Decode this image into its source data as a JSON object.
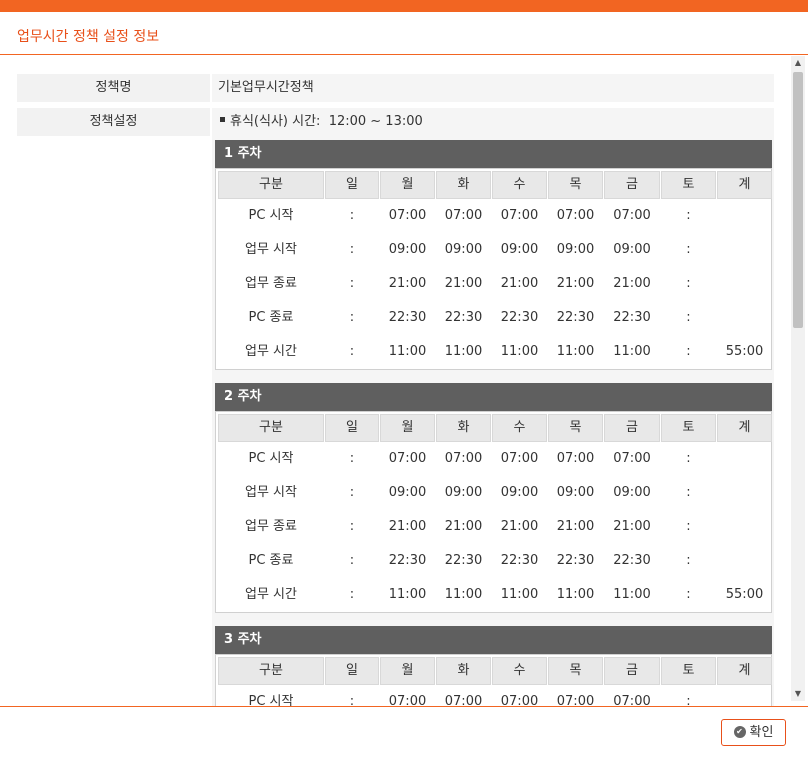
{
  "dialog": {
    "title": "업무시간 정책 설정 정보"
  },
  "fields": {
    "policy_name_label": "정책명",
    "policy_name_value": "기본업무시간정책",
    "policy_setting_label": "정책설정",
    "break_time_label": "휴식(식사) 시간:",
    "break_time_value": "12:00 ~ 13:00"
  },
  "table_headers": [
    "구분",
    "일",
    "월",
    "화",
    "수",
    "목",
    "금",
    "토",
    "계"
  ],
  "weeks": [
    {
      "title": "1 주차",
      "rows": [
        [
          "PC 시작",
          ":",
          "07:00",
          "07:00",
          "07:00",
          "07:00",
          "07:00",
          ":",
          ""
        ],
        [
          "업무 시작",
          ":",
          "09:00",
          "09:00",
          "09:00",
          "09:00",
          "09:00",
          ":",
          ""
        ],
        [
          "업무 종료",
          ":",
          "21:00",
          "21:00",
          "21:00",
          "21:00",
          "21:00",
          ":",
          ""
        ],
        [
          "PC 종료",
          ":",
          "22:30",
          "22:30",
          "22:30",
          "22:30",
          "22:30",
          ":",
          ""
        ],
        [
          "업무 시간",
          ":",
          "11:00",
          "11:00",
          "11:00",
          "11:00",
          "11:00",
          ":",
          "55:00"
        ]
      ]
    },
    {
      "title": "2 주차",
      "rows": [
        [
          "PC 시작",
          ":",
          "07:00",
          "07:00",
          "07:00",
          "07:00",
          "07:00",
          ":",
          ""
        ],
        [
          "업무 시작",
          ":",
          "09:00",
          "09:00",
          "09:00",
          "09:00",
          "09:00",
          ":",
          ""
        ],
        [
          "업무 종료",
          ":",
          "21:00",
          "21:00",
          "21:00",
          "21:00",
          "21:00",
          ":",
          ""
        ],
        [
          "PC 종료",
          ":",
          "22:30",
          "22:30",
          "22:30",
          "22:30",
          "22:30",
          ":",
          ""
        ],
        [
          "업무 시간",
          ":",
          "11:00",
          "11:00",
          "11:00",
          "11:00",
          "11:00",
          ":",
          "55:00"
        ]
      ]
    },
    {
      "title": "3 주차",
      "rows": [
        [
          "PC 시작",
          ":",
          "07:00",
          "07:00",
          "07:00",
          "07:00",
          "07:00",
          ":",
          ""
        ]
      ]
    }
  ],
  "footer": {
    "ok_label": "확인"
  },
  "colors": {
    "accent": "#f26522",
    "week_header": "#5f5f5f"
  }
}
